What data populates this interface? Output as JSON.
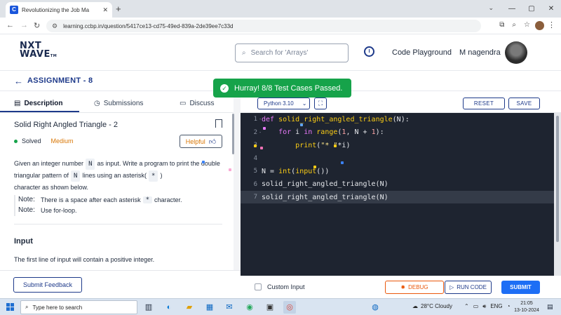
{
  "browser": {
    "tab_title": "Revolutionizing the Job Ma",
    "tab_favicon": "C",
    "new_tab": "+",
    "url": "learning.ccbp.in/question/5417ce13-cd75-49ed-839a-2de39ee7c33d",
    "window_controls": [
      "—",
      "▢",
      "✕"
    ]
  },
  "site": {
    "logo_line1": "NXT",
    "logo_line2": "WAVE",
    "logo_tm": "TM",
    "search_placeholder": "Search for 'Arrays'",
    "code_playground": "Code Playground",
    "user_name": "M nagendra"
  },
  "assignment": {
    "title": "ASSIGNMENT - 8",
    "toast": "Hurray! 8/8 Test Cases Passed."
  },
  "left_tabs": [
    {
      "label": "Description",
      "icon": "document-icon"
    },
    {
      "label": "Submissions",
      "icon": "clock-icon"
    },
    {
      "label": "Discuss",
      "icon": "chat-icon"
    }
  ],
  "question": {
    "title": "Solid Right Angled Triangle - 2",
    "status": "Solved",
    "difficulty": "Medium",
    "helpful": "Helpful",
    "desc_1": "Given an integer number",
    "chip_n": "N",
    "desc_2": "as input. Write a program to print the double triangular pattern of",
    "desc_3": "lines using an asterisk(",
    "chip_star": "*",
    "desc_4": ")",
    "desc_5": "character as shown below.",
    "note_label": "Note:",
    "note_1a": "There is a space after each asterisk",
    "note_1b": "character.",
    "note_2": "Use for-loop.",
    "input_heading": "Input",
    "input_text": "The first line of input will contain a positive integer.",
    "feedback": "Submit Feedback"
  },
  "editor": {
    "language": "Python 3.10",
    "reset": "RESET",
    "save": "SAVE",
    "lines": [
      {
        "n": "1",
        "fold": "-",
        "tokens": [
          {
            "t": "def ",
            "c": "kw"
          },
          {
            "t": "solid_right_angled_triangle",
            "c": "fn"
          },
          {
            "t": "(N):",
            "c": "ident"
          }
        ]
      },
      {
        "n": "2",
        "fold": "-",
        "tokens": [
          {
            "t": "    for ",
            "c": "kw"
          },
          {
            "t": "i ",
            "c": "ident"
          },
          {
            "t": "in ",
            "c": "kw"
          },
          {
            "t": "range",
            "c": "fn"
          },
          {
            "t": "(",
            "c": "ident"
          },
          {
            "t": "1",
            "c": "num"
          },
          {
            "t": ", N + ",
            "c": "ident"
          },
          {
            "t": "1",
            "c": "num"
          },
          {
            "t": "):",
            "c": "ident"
          }
        ]
      },
      {
        "n": "3",
        "fold": "",
        "tokens": [
          {
            "t": "        ",
            "c": "ident"
          },
          {
            "t": "print",
            "c": "fn"
          },
          {
            "t": "(",
            "c": "ident"
          },
          {
            "t": "\"* \"",
            "c": "str"
          },
          {
            "t": "*i)",
            "c": "ident"
          }
        ]
      },
      {
        "n": "4",
        "fold": "",
        "tokens": []
      },
      {
        "n": "5",
        "fold": "",
        "tokens": [
          {
            "t": "N = ",
            "c": "ident"
          },
          {
            "t": "int",
            "c": "fn"
          },
          {
            "t": "(",
            "c": "ident"
          },
          {
            "t": "input",
            "c": "fn"
          },
          {
            "t": "())",
            "c": "ident"
          }
        ]
      },
      {
        "n": "6",
        "fold": "",
        "tokens": [
          {
            "t": "solid_right_angled_triangle(N)",
            "c": "ident"
          }
        ]
      },
      {
        "n": "7",
        "fold": "",
        "tokens": [
          {
            "t": "solid_right_angled_triangle(N)",
            "c": "ident"
          }
        ]
      }
    ],
    "custom_input": "Custom Input",
    "debug": "DEBUG",
    "run": "RUN CODE",
    "submit": "SUBMIT"
  },
  "taskbar": {
    "search": "Type here to search",
    "weather": "28°C  Cloudy",
    "lang": "ENG",
    "time": "21:05",
    "date": "13-10-2024"
  },
  "colors": {
    "brand_blue": "#1e3a8a",
    "success_green": "#16a34a",
    "medium_orange": "#d97706",
    "editor_bg": "#1e2430"
  }
}
